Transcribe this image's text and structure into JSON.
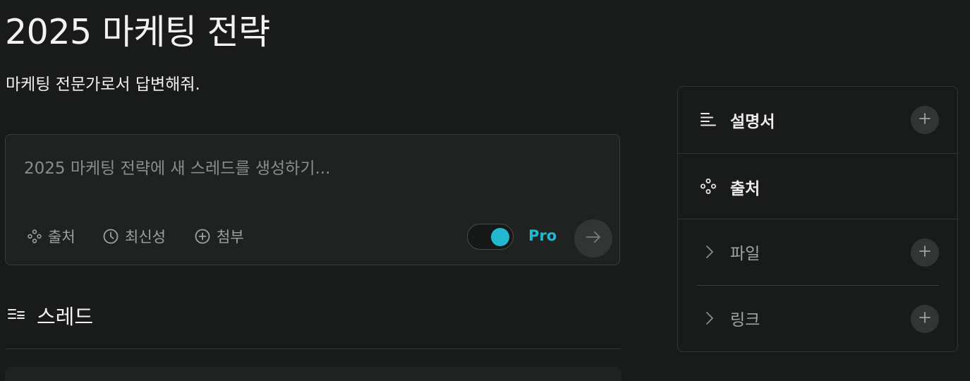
{
  "space": {
    "title": "2025 마케팅 전략",
    "instructions": "마케팅 전문가로서 답변해줘."
  },
  "composer": {
    "placeholder": "2025 마케팅 전략에 새 스레드를 생성하기...",
    "value": "",
    "sources_label": "출처",
    "recency_label": "최신성",
    "attach_label": "첨부",
    "pro_label": "Pro",
    "pro_enabled": true
  },
  "threads": {
    "title": "스레드"
  },
  "side_panel": {
    "description_label": "설명서",
    "sources_label": "출처",
    "files_label": "파일",
    "links_label": "링크"
  },
  "colors": {
    "accent": "#21b8d0",
    "background": "#191a1a",
    "surface": "#202222"
  },
  "icons": {
    "sources": "sources-icon",
    "recency": "clock-icon",
    "attach": "plus-circle-icon",
    "send": "arrow-right-icon",
    "threads": "threads-icon",
    "description": "text-lines-icon",
    "chevron": "chevron-right-icon",
    "add": "plus-icon"
  }
}
